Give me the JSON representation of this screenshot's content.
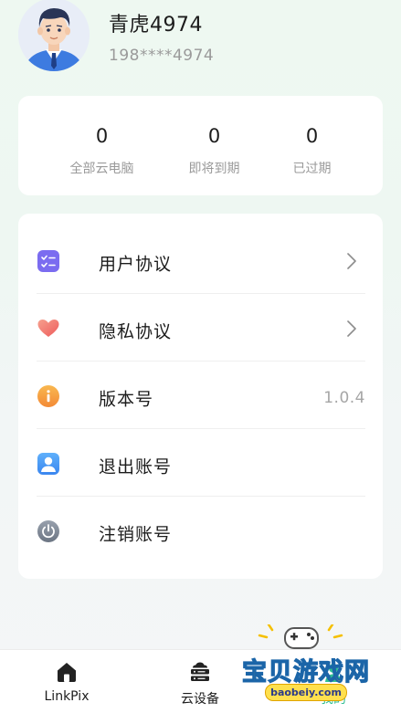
{
  "profile": {
    "username": "青虎4974",
    "phone": "198****4974"
  },
  "stats": [
    {
      "value": "0",
      "label": "全部云电脑"
    },
    {
      "value": "0",
      "label": "即将到期"
    },
    {
      "value": "0",
      "label": "已过期"
    }
  ],
  "menu": [
    {
      "label": "用户协议",
      "icon": "checklist-icon",
      "has_chevron": true
    },
    {
      "label": "隐私协议",
      "icon": "heart-icon",
      "has_chevron": true
    },
    {
      "label": "版本号",
      "icon": "info-icon",
      "value": "1.0.4"
    },
    {
      "label": "退出账号",
      "icon": "user-logout-icon"
    },
    {
      "label": "注销账号",
      "icon": "power-icon"
    }
  ],
  "tabbar": {
    "tabs": [
      {
        "label": "LinkPix",
        "icon": "home-icon",
        "active": false
      },
      {
        "label": "云设备",
        "icon": "cloud-server-icon",
        "active": false
      },
      {
        "label": "我的",
        "icon": "profile-icon",
        "active": true
      }
    ],
    "active_color": "#2fbf92"
  },
  "watermark": {
    "title": "宝贝游戏网",
    "url": "baobeiy.com"
  },
  "colors": {
    "menu_icon_purple": "#7b6cf0",
    "menu_icon_heart": "#f2736d",
    "menu_icon_orange": "#f59a3e",
    "menu_icon_blue": "#3f8ff2",
    "menu_icon_gray": "#7e8795"
  }
}
